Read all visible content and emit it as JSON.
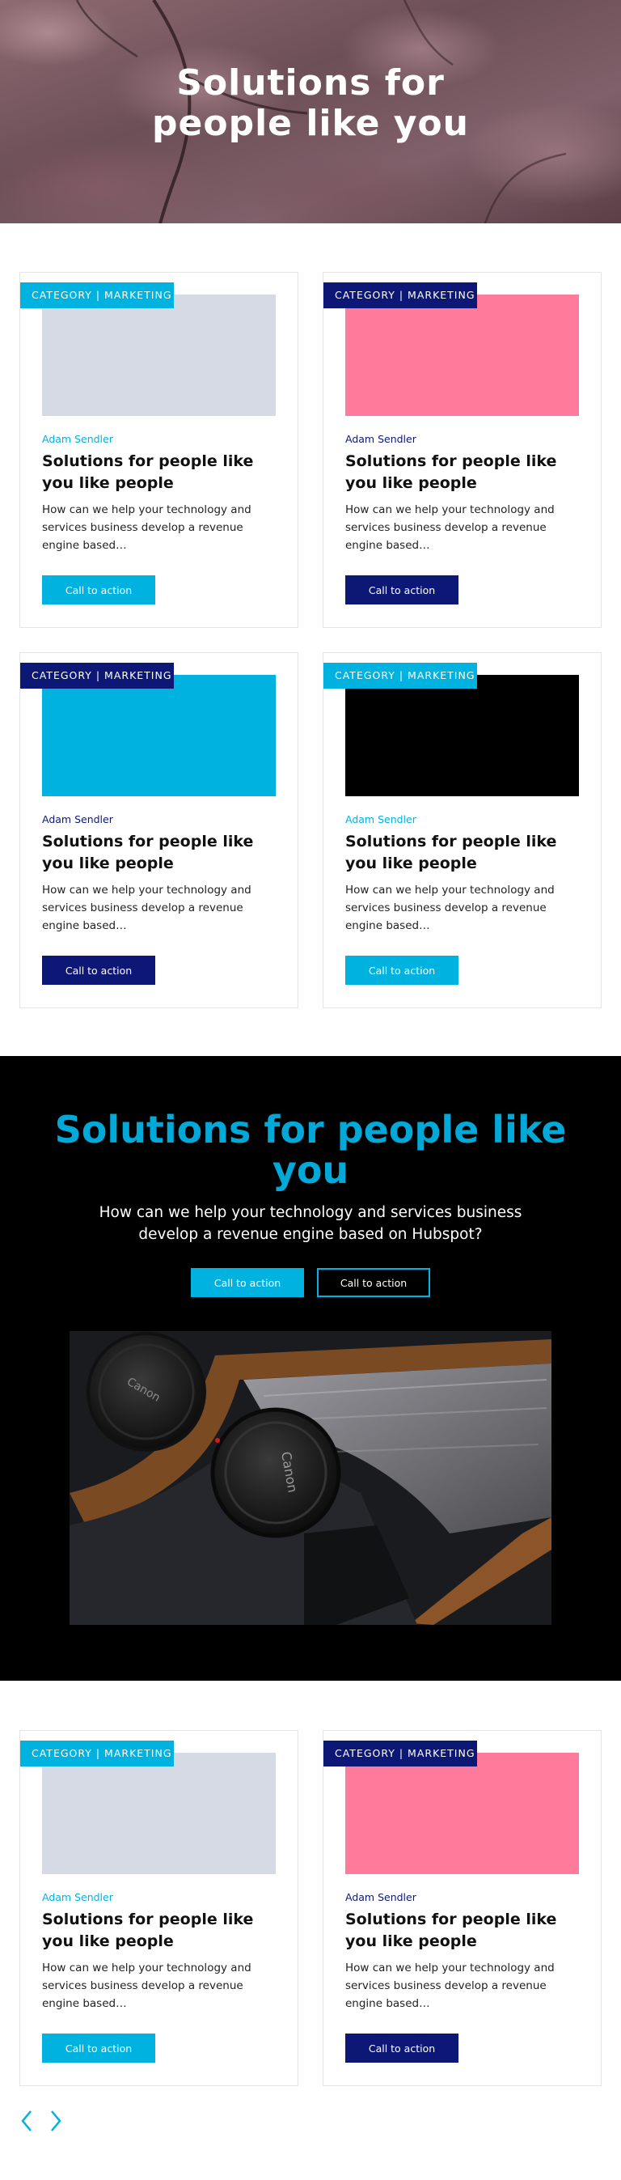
{
  "hero": {
    "title_line1": "Solutions for",
    "title_line2": "people like you"
  },
  "colors": {
    "cyan": "#00b2df",
    "navy": "#0d1776",
    "pink": "#ff7a9b",
    "grey_thumb": "#d5dae5",
    "black": "#000000"
  },
  "cards_group1": [
    {
      "category": "CATEGORY | MARKETING",
      "author": "Adam Sendler",
      "title": "Solutions for people like you like people",
      "description": "How can we help your technology and services business develop a revenue engine based…",
      "cta": "Call to action"
    },
    {
      "category": "CATEGORY | MARKETING",
      "author": "Adam Sendler",
      "title": "Solutions for people like you like people",
      "description": "How can we help your technology and services business develop a revenue engine based…",
      "cta": "Call to action"
    },
    {
      "category": "CATEGORY | MARKETING",
      "author": "Adam Sendler",
      "title": "Solutions for people like you like people",
      "description": "How can we help your technology and services business develop a revenue engine based…",
      "cta": "Call to action"
    },
    {
      "category": "CATEGORY | MARKETING",
      "author": "Adam Sendler",
      "title": "Solutions for people like you like people",
      "description": "How can we help your technology and services business develop a revenue engine based…",
      "cta": "Call to action"
    }
  ],
  "feature": {
    "title_line1": "Solutions for people like",
    "title_line2": "you",
    "subtitle": "How can we help your technology and services business develop a revenue engine based on Hubspot?",
    "primary_cta": "Call to action",
    "secondary_cta": "Call to action"
  },
  "cards_group2": [
    {
      "category": "CATEGORY | MARKETING",
      "author": "Adam Sendler",
      "title": "Solutions for people like you like people",
      "description": "How can we help your technology and services business develop a revenue engine based…",
      "cta": "Call to action"
    },
    {
      "category": "CATEGORY | MARKETING",
      "author": "Adam Sendler",
      "title": "Solutions for people like you like people",
      "description": "How can we help your technology and services business develop a revenue engine based…",
      "cta": "Call to action"
    }
  ],
  "carousel": {
    "prev_icon": "chevron-left-icon",
    "next_icon": "chevron-right-icon"
  }
}
